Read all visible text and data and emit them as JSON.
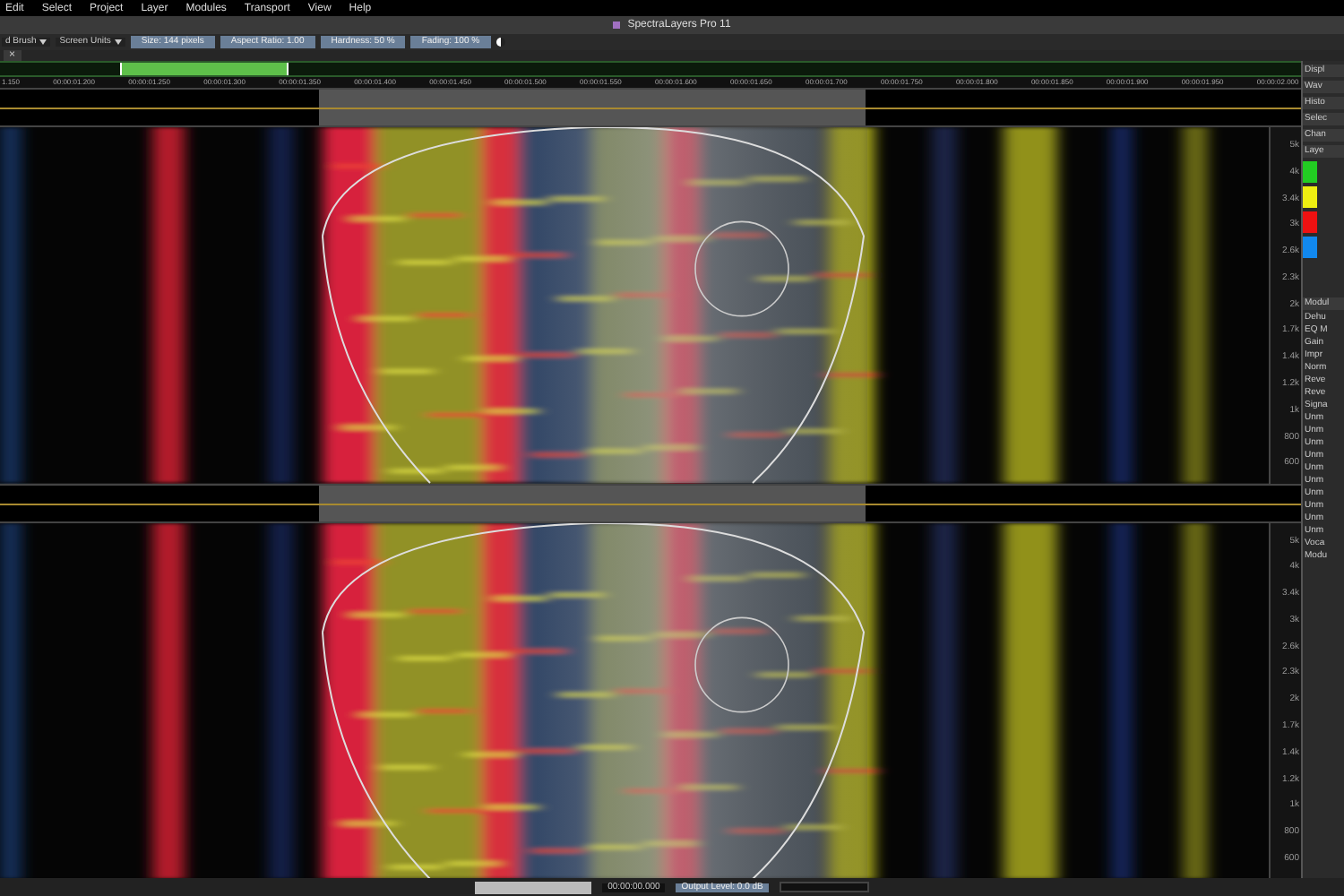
{
  "menu": [
    "Edit",
    "Select",
    "Project",
    "Layer",
    "Modules",
    "Transport",
    "View",
    "Help"
  ],
  "window": {
    "title": "SpectraLayers Pro 11"
  },
  "toolbar": {
    "tool": "d Brush",
    "units": "Screen Units",
    "fields": [
      "Size: 144 pixels",
      "Aspect Ratio: 1.00",
      "Hardness: 50 %",
      "Fading: 100 %"
    ]
  },
  "tab": {
    "close": "×"
  },
  "ruler": [
    "1.150",
    "00:00:01.200",
    "00:00:01.250",
    "00:00:01.300",
    "00:00:01.350",
    "00:00:01.400",
    "00:00:01.450",
    "00:00:01.500",
    "00:00:01.550",
    "00:00:01.600",
    "00:00:01.650",
    "00:00:01.700",
    "00:00:01.750",
    "00:00:01.800",
    "00:00:01.850",
    "00:00:01.900",
    "00:00:01.950",
    "00:00:02.000"
  ],
  "channels": [
    {
      "frequencies": [
        "5k",
        "4k",
        "3.4k",
        "3k",
        "2.6k",
        "2.3k",
        "2k",
        "1.7k",
        "1.4k",
        "1.2k",
        "1k",
        "800",
        "600"
      ]
    },
    {
      "frequencies": [
        "5k",
        "4k",
        "3.4k",
        "3k",
        "2.6k",
        "2.3k",
        "2k",
        "1.7k",
        "1.4k",
        "1.2k",
        "1k",
        "800",
        "600"
      ]
    }
  ],
  "right_panel": {
    "top": [
      "Displ",
      "Wav",
      "Histo",
      "Selec",
      "Chan",
      "Laye"
    ],
    "layers": [
      {
        "color": "#22cc22"
      },
      {
        "color": "#eeee11"
      },
      {
        "color": "#ee1111"
      },
      {
        "color": "#1188ee"
      }
    ],
    "modules_title": "Modul",
    "modules": [
      "Dehu",
      "EQ M",
      "Gain",
      "Impr",
      "Norm",
      "Reve",
      "Reve",
      "Signa",
      "Unm",
      "Unm",
      "Unm",
      "Unm",
      "Unm",
      "Unm",
      "Unm",
      "Unm",
      "Unm",
      "Unm",
      "Voca",
      "Modu"
    ]
  },
  "transport": {
    "time": "00:00:00.000",
    "output": "Output Level: 0.0 dB"
  }
}
